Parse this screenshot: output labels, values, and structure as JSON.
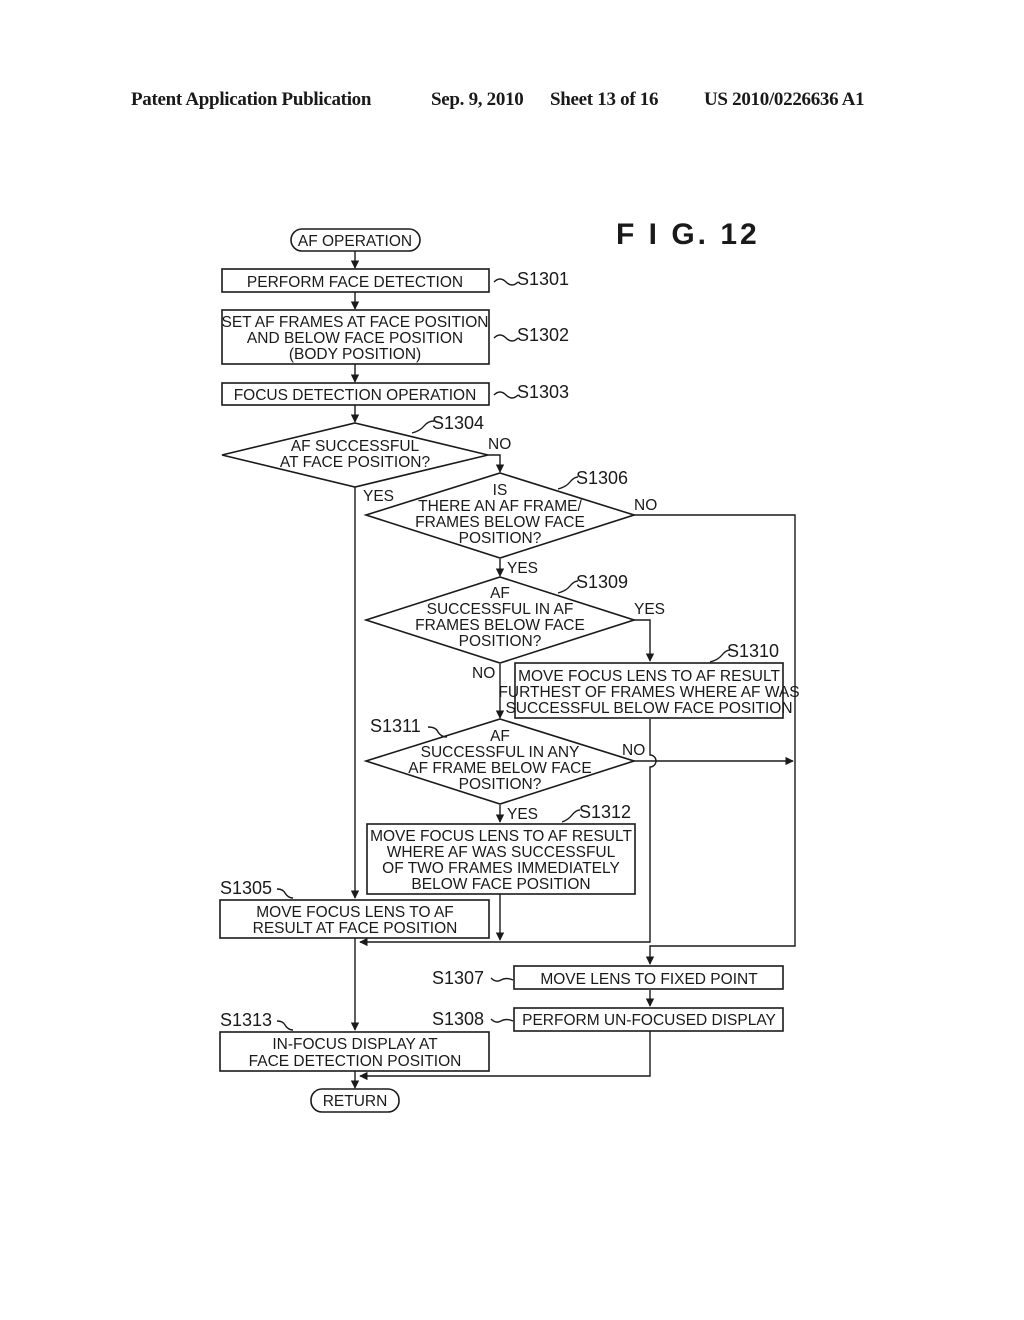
{
  "header": {
    "publication": "Patent Application Publication",
    "date": "Sep. 9, 2010",
    "sheet": "Sheet 13 of 16",
    "number": "US 2010/0226636 A1"
  },
  "figure": {
    "label": "F I G.  12"
  },
  "flowchart": {
    "start": {
      "text": "AF OPERATION"
    },
    "end": {
      "text": "RETURN"
    },
    "steps": {
      "s1301": {
        "id": "S1301",
        "lines": [
          "PERFORM FACE DETECTION"
        ]
      },
      "s1302": {
        "id": "S1302",
        "lines": [
          "SET AF FRAMES AT FACE POSITION",
          "AND BELOW FACE POSITION",
          "(BODY POSITION)"
        ]
      },
      "s1303": {
        "id": "S1303",
        "lines": [
          "FOCUS DETECTION OPERATION"
        ]
      },
      "s1304": {
        "id": "S1304",
        "type": "decision",
        "lines": [
          "AF SUCCESSFUL",
          "AT FACE POSITION?"
        ]
      },
      "s1305": {
        "id": "S1305",
        "lines": [
          "MOVE FOCUS LENS TO AF",
          "RESULT AT FACE POSITION"
        ]
      },
      "s1306": {
        "id": "S1306",
        "type": "decision",
        "lines": [
          "IS",
          "THERE AN AF FRAME/",
          "FRAMES BELOW FACE",
          "POSITION?"
        ]
      },
      "s1307": {
        "id": "S1307",
        "lines": [
          "MOVE LENS TO FIXED POINT"
        ]
      },
      "s1308": {
        "id": "S1308",
        "lines": [
          "PERFORM UN-FOCUSED DISPLAY"
        ]
      },
      "s1309": {
        "id": "S1309",
        "type": "decision",
        "lines": [
          "AF",
          "SUCCESSFUL IN AF",
          "FRAMES BELOW FACE",
          "POSITION?"
        ]
      },
      "s1310": {
        "id": "S1310",
        "lines": [
          "MOVE FOCUS LENS TO AF RESULT",
          "FURTHEST OF FRAMES WHERE AF WAS",
          "SUCCESSFUL BELOW FACE POSITION"
        ]
      },
      "s1311": {
        "id": "S1311",
        "type": "decision",
        "lines": [
          "AF",
          "SUCCESSFUL IN ANY",
          "AF FRAME BELOW FACE",
          "POSITION?"
        ]
      },
      "s1312": {
        "id": "S1312",
        "lines": [
          "MOVE FOCUS LENS TO AF RESULT",
          "WHERE AF WAS SUCCESSFUL",
          "OF TWO FRAMES IMMEDIATELY",
          "BELOW FACE POSITION"
        ]
      },
      "s1313": {
        "id": "S1313",
        "lines": [
          "IN-FOCUS DISPLAY AT",
          "FACE DETECTION POSITION"
        ]
      }
    },
    "branch_labels": {
      "s1304_yes": "YES",
      "s1304_no": "NO",
      "s1306_yes": "YES",
      "s1306_no": "NO",
      "s1309_yes": "YES",
      "s1309_no": "NO",
      "s1311_yes": "YES",
      "s1311_no": "NO"
    }
  }
}
